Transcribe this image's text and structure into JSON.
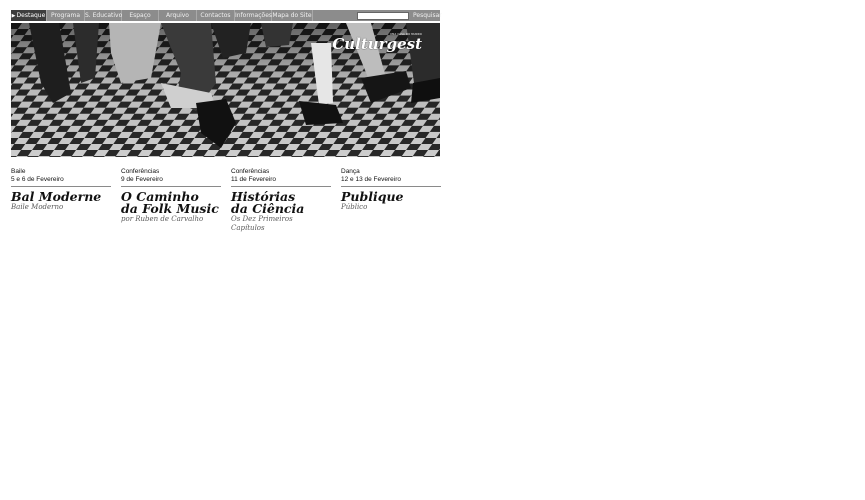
{
  "nav": {
    "items": [
      {
        "label": "Destaque",
        "active": true
      },
      {
        "label": "Programa"
      },
      {
        "label": "S. Educativo"
      },
      {
        "label": "Espaço"
      },
      {
        "label": "Arquivo"
      },
      {
        "label": "Contactos"
      },
      {
        "label": "Informações"
      },
      {
        "label": "Mapa do Site"
      }
    ],
    "search_placeholder": "",
    "search_button": "Pesquisar"
  },
  "hero": {
    "logo_text": "Culturgest",
    "logo_tagline": "UMA CASA DO MUNDO"
  },
  "events": [
    {
      "category": "Baile",
      "date": "5 e 6 de Fevereiro",
      "title_lines": [
        "Bal Moderne"
      ],
      "subtitle_lines": [
        "Baile Moderno"
      ]
    },
    {
      "category": "Conferências",
      "date": "9 de Fevereiro",
      "title_lines": [
        "O Caminho",
        "da Folk Music"
      ],
      "subtitle_lines": [
        "por Ruben de Carvalho"
      ]
    },
    {
      "category": "Conferências",
      "date": "11 de Fevereiro",
      "title_lines": [
        "Histórias",
        "da Ciência"
      ],
      "subtitle_lines": [
        "Os Dez Primeiros",
        "Capítulos"
      ]
    },
    {
      "category": "Dança",
      "date": "12 e 13 de Fevereiro",
      "title_lines": [
        "Publique"
      ],
      "subtitle_lines": [
        "Público"
      ]
    }
  ],
  "colors": {
    "nav_bg": "#8c8c8c",
    "nav_active": "#3d3d3d",
    "text": "#111111",
    "subtitle": "#5a5a5a"
  }
}
